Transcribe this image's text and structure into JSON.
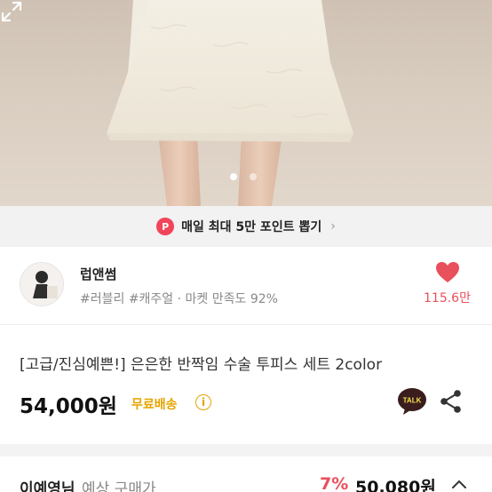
{
  "gallery": {
    "total_images": 2,
    "active_index": 0,
    "expand_icon": "expand-icon"
  },
  "promo": {
    "badge": "P",
    "text": "매일 최대 5만 포인트 뽑기",
    "chevron": "›"
  },
  "shop": {
    "name": "럽앤썸",
    "tags": "#러블리 #캐주얼 · 마켓 만족도 92%",
    "likes": "115.6만"
  },
  "product": {
    "title": "[고급/진심예쁜!]  은은한 반짝임 수술 투피스 세트 2color",
    "price": "54,000원",
    "shipping": "무료배송",
    "shipping_info": "i"
  },
  "expected_price": {
    "buyer": "이예영님",
    "label": "예상 구매가",
    "discount": "7%",
    "price": "50,080원"
  },
  "colors": {
    "accent": "#e8505b",
    "shipping": "#e5a400",
    "promo_badge": "#f0455a",
    "talk": "#3a1d1d"
  }
}
